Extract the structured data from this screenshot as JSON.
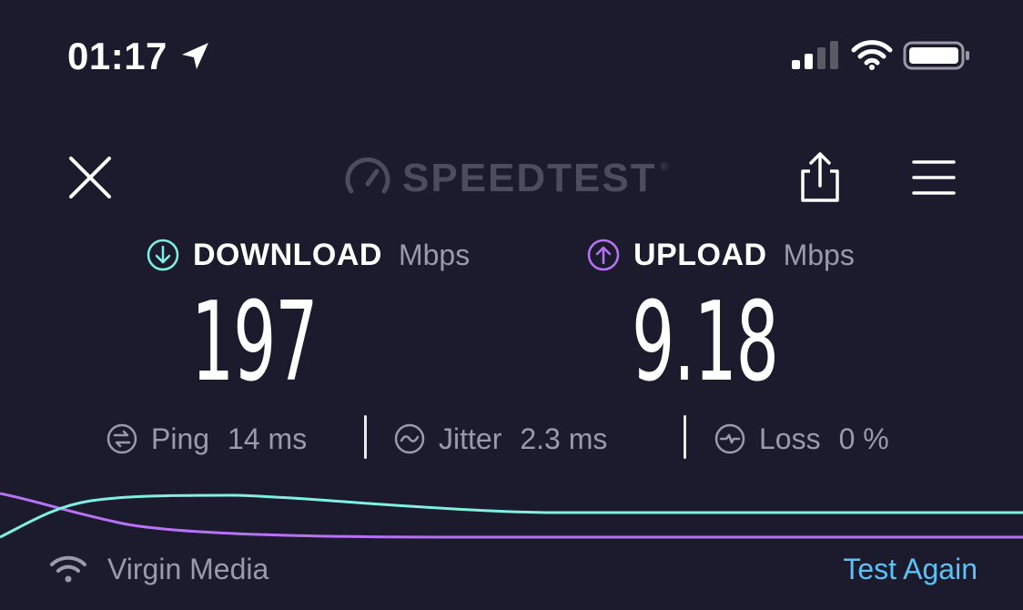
{
  "status_bar": {
    "time": "01:17",
    "icons": [
      "location-arrow-icon",
      "cellular-signal-icon",
      "wifi-icon",
      "battery-icon"
    ]
  },
  "header": {
    "logo_text": "SPEEDTEST",
    "logo_mark": "®",
    "close_icon": "close-icon",
    "share_icon": "share-icon",
    "menu_icon": "menu-icon"
  },
  "download": {
    "label": "DOWNLOAD",
    "unit": "Mbps",
    "value": "197",
    "color": "#7ff0e1"
  },
  "upload": {
    "label": "UPLOAD",
    "unit": "Mbps",
    "value": "9.18",
    "color": "#b872f5"
  },
  "stats": {
    "ping": {
      "label": "Ping",
      "value": "14 ms"
    },
    "jitter": {
      "label": "Jitter",
      "value": "2.3 ms"
    },
    "loss": {
      "label": "Loss",
      "value": "0 %"
    }
  },
  "footer": {
    "provider": "Virgin Media",
    "test_again": "Test Again",
    "accent": "#5ac2f7"
  }
}
